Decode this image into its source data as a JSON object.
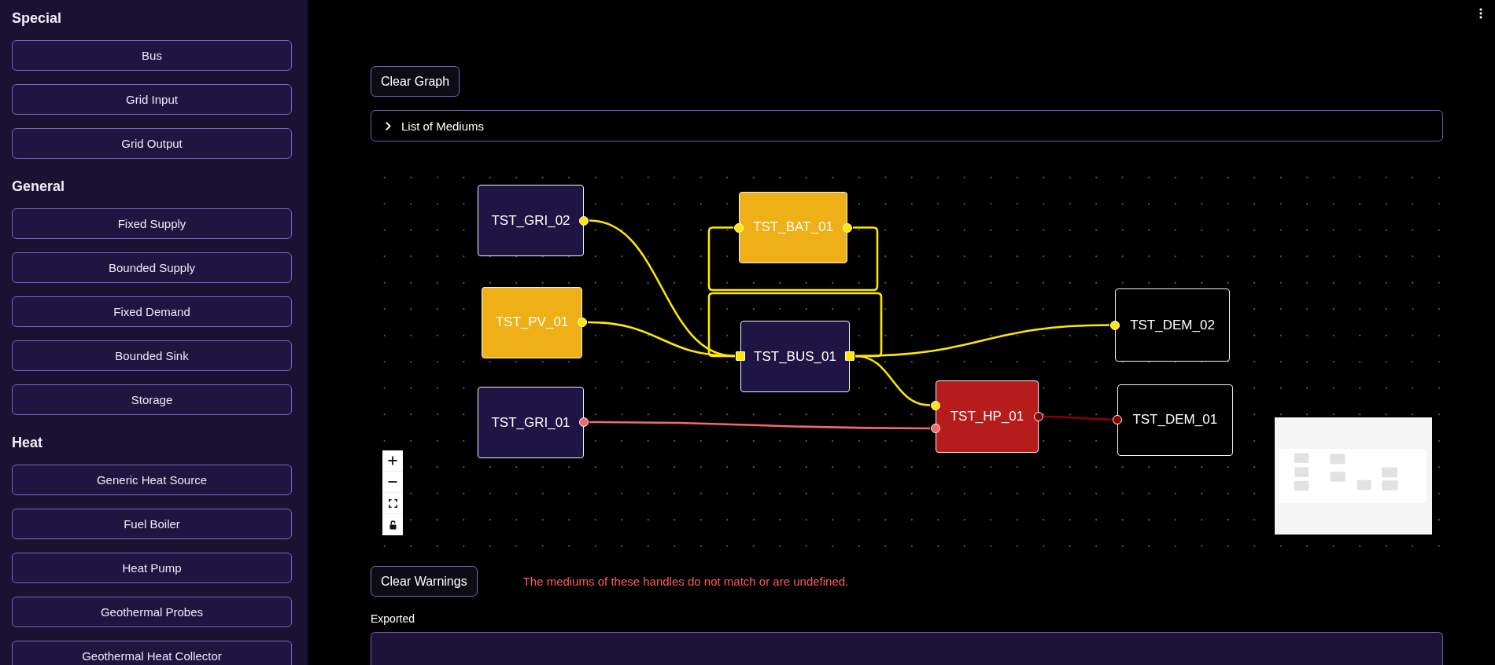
{
  "sidebar": {
    "sections": [
      {
        "heading": "Special",
        "items": [
          "Bus",
          "Grid Input",
          "Grid Output"
        ]
      },
      {
        "heading": "General",
        "items": [
          "Fixed Supply",
          "Bounded Supply",
          "Fixed Demand",
          "Bounded Sink",
          "Storage"
        ]
      },
      {
        "heading": "Heat",
        "items": [
          "Generic Heat Source",
          "Fuel Boiler",
          "Heat Pump",
          "Geothermal Probes",
          "Geothermal Heat Collector"
        ]
      }
    ]
  },
  "toolbar": {
    "clear_graph_button": "Clear Graph"
  },
  "mediums_panel": {
    "label": "List of Mediums",
    "expanded": false
  },
  "graph": {
    "nodes": [
      {
        "label": "TST_GRI_02",
        "kind": "component",
        "color": "#1e1545",
        "handles": [
          {
            "color": "#ffe800"
          }
        ]
      },
      {
        "label": "TST_BAT_01",
        "kind": "component",
        "color": "#eeb016",
        "handles": [
          {
            "color": "#ffe800"
          },
          {
            "color": "#ffe800"
          }
        ]
      },
      {
        "label": "TST_PV_01",
        "kind": "component",
        "color": "#eeb016",
        "handles": [
          {
            "color": "#ffe800"
          }
        ]
      },
      {
        "label": "TST_BUS_01",
        "kind": "bus",
        "color": "#1e1545",
        "handles": [
          {
            "color": "#ffe800"
          },
          {
            "color": "#ffe800"
          }
        ]
      },
      {
        "label": "TST_DEM_02",
        "kind": "component",
        "color": "#000000",
        "handles": [
          {
            "color": "#ffe800"
          }
        ]
      },
      {
        "label": "TST_GRI_01",
        "kind": "component",
        "color": "#1e1545",
        "handles": [
          {
            "color": "#f26a6a"
          }
        ]
      },
      {
        "label": "TST_HP_01",
        "kind": "component",
        "color": "#b71c1c",
        "handles": [
          {
            "color": "#ffe800"
          },
          {
            "color": "#f26a6a"
          },
          {
            "color": "#8b0000"
          }
        ]
      },
      {
        "label": "TST_DEM_01",
        "kind": "component",
        "color": "#000000",
        "handles": [
          {
            "color": "#8b0000"
          }
        ]
      }
    ],
    "edges": [
      {
        "color": "#ffe800"
      },
      {
        "color": "#ffe800"
      },
      {
        "color": "#ffe800"
      },
      {
        "color": "#ffe800"
      },
      {
        "color": "#ffe800"
      },
      {
        "color": "#ffe800"
      },
      {
        "color": "#f26a6a"
      },
      {
        "color": "#8b0000"
      }
    ],
    "controls": {
      "locked": false
    }
  },
  "warnings": {
    "clear_button": "Clear Warnings",
    "message": "The mediums of these handles do not match or are undefined."
  },
  "export": {
    "label": "Exported"
  }
}
